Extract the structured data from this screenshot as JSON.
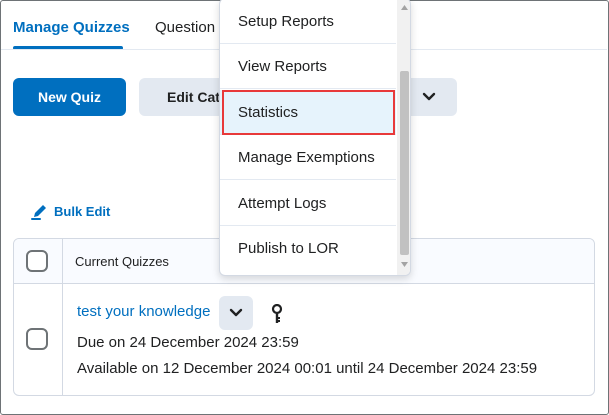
{
  "tabs": {
    "manage_quizzes": "Manage Quizzes",
    "question": "Question"
  },
  "toolbar": {
    "new_quiz": "New Quiz",
    "edit_categories": "Edit Cate"
  },
  "bulk_edit": {
    "label": "Bulk Edit",
    "icon": "pencil-icon"
  },
  "table": {
    "header": "Current Quizzes",
    "rows": [
      {
        "title": "test your knowledge",
        "due": "Due on 24 December 2024 23:59",
        "available": "Available on 12 December 2024 00:01 until 24 December 2024 23:59"
      }
    ]
  },
  "menu": {
    "items": [
      {
        "label": "Setup Reports"
      },
      {
        "label": "View Reports"
      },
      {
        "label": "Statistics",
        "highlighted": true
      },
      {
        "label": "Manage Exemptions"
      },
      {
        "label": "Attempt Logs"
      },
      {
        "label": "Publish to LOR"
      }
    ]
  },
  "colors": {
    "primary": "#006fbf",
    "secondary_bg": "#e3e9f1",
    "highlight_border": "#e8393a"
  }
}
